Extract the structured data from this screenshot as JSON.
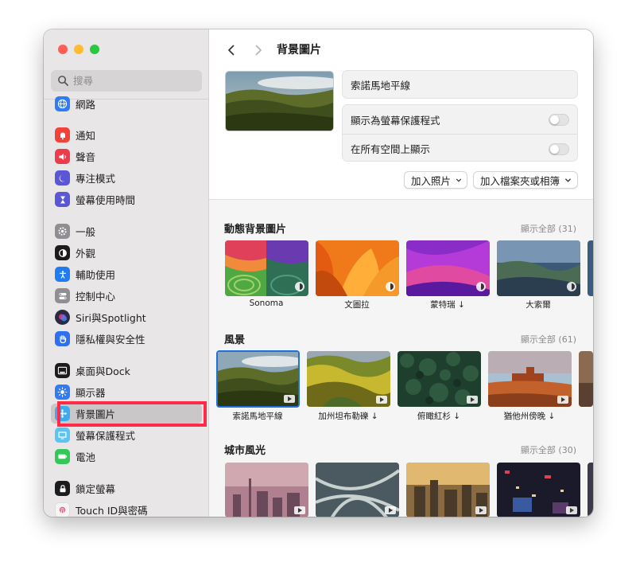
{
  "sidebar": {
    "search_placeholder": "搜尋",
    "items": [
      {
        "label": "網路",
        "icon": "globe-icon",
        "color": "#2f7cf6"
      },
      {
        "label": "通知",
        "icon": "bell-icon",
        "color": "#f0443a"
      },
      {
        "label": "聲音",
        "icon": "speaker-icon",
        "color": "#ec3b4b"
      },
      {
        "label": "專注模式",
        "icon": "moon-icon",
        "color": "#5b56d6"
      },
      {
        "label": "螢幕使用時間",
        "icon": "hourglass-icon",
        "color": "#5b56d6"
      },
      {
        "label": "一般",
        "icon": "gear-icon",
        "color": "#8e8e93"
      },
      {
        "label": "外觀",
        "icon": "appearance-icon",
        "color": "#1c1c1e"
      },
      {
        "label": "輔助使用",
        "icon": "accessibility-icon",
        "color": "#1f7cf3"
      },
      {
        "label": "控制中心",
        "icon": "toggles-icon",
        "color": "#8e8e93"
      },
      {
        "label": "Siri與Spotlight",
        "icon": "siri-icon",
        "color": "#2a2a45"
      },
      {
        "label": "隱私權與安全性",
        "icon": "hand-icon",
        "color": "#2f6ff0"
      },
      {
        "label": "桌面與Dock",
        "icon": "dock-icon",
        "color": "#1c1c1e"
      },
      {
        "label": "顯示器",
        "icon": "sun-icon",
        "color": "#2f7cf6"
      },
      {
        "label": "背景圖片",
        "icon": "wallpaper-icon",
        "color": "#3eaaf0"
      },
      {
        "label": "螢幕保護程式",
        "icon": "screensaver-icon",
        "color": "#5ac4f2"
      },
      {
        "label": "電池",
        "icon": "battery-icon",
        "color": "#34c759"
      },
      {
        "label": "鎖定螢幕",
        "icon": "lock-icon",
        "color": "#1c1c1e"
      },
      {
        "label": "Touch ID與密碼",
        "icon": "fingerprint-icon",
        "color": "#f5f5f5"
      }
    ]
  },
  "main": {
    "title": "背景圖片",
    "current_wallpaper": "索諾馬地平線",
    "toggle_screensaver": "顯示為螢幕保護程式",
    "toggle_all_spaces": "在所有空間上顯示",
    "add_photo": "加入照片",
    "add_folder": "加入檔案夾或相簿"
  },
  "sections": [
    {
      "title": "動態背景圖片",
      "show_all": "顯示全部 (31)",
      "items": [
        {
          "label": "Sonoma"
        },
        {
          "label": "文圖拉"
        },
        {
          "label": "蒙特瑞 ↓"
        },
        {
          "label": "大索爾"
        }
      ]
    },
    {
      "title": "風景",
      "show_all": "顯示全部 (61)",
      "items": [
        {
          "label": "索諾馬地平線"
        },
        {
          "label": "加州坦布勒礫 ↓"
        },
        {
          "label": "俯瞰紅杉 ↓"
        },
        {
          "label": "猶他州傍晚 ↓"
        }
      ]
    },
    {
      "title": "城市風光",
      "show_all": "顯示全部 (30)",
      "items": [
        {
          "label": ""
        },
        {
          "label": ""
        },
        {
          "label": ""
        },
        {
          "label": ""
        }
      ]
    }
  ],
  "colors": {
    "selection_highlight": "#ff2b47",
    "accent": "#1f6fdc"
  }
}
